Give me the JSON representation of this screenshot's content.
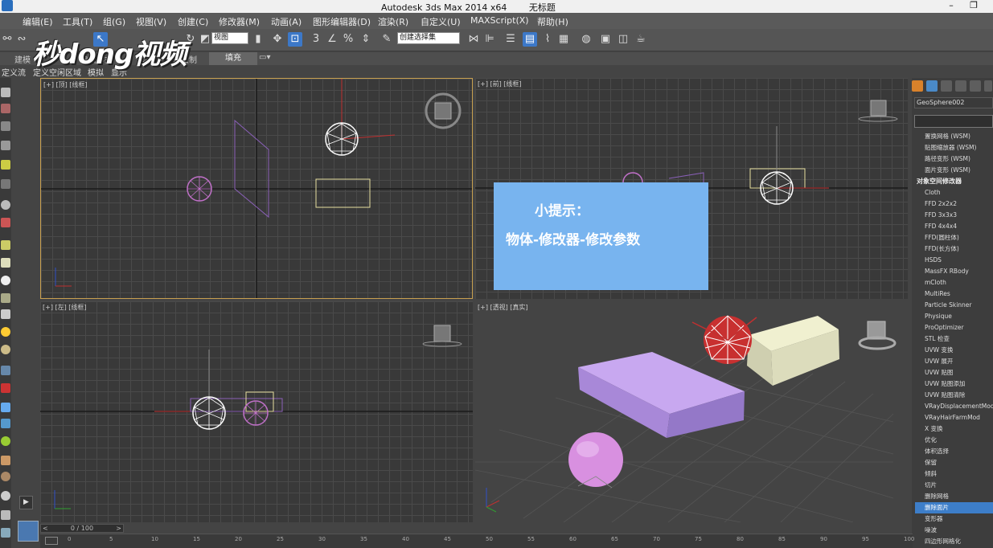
{
  "window": {
    "title_app": "Autodesk 3ds Max  2014 x64",
    "title_doc": "无标题",
    "minimize": "–",
    "restore": "❐"
  },
  "menubar": [
    "编辑(E)",
    "工具(T)",
    "组(G)",
    "视图(V)",
    "创建(C)",
    "修改器(M)",
    "动画(A)",
    "图形编辑器(D)",
    "渲染(R)",
    "自定义(U)",
    "MAXScript(X)",
    "帮助(H)"
  ],
  "toolbar": {
    "view_select": "视图",
    "selection_set": "创建选择集",
    "snap_3": "3",
    "snap_angle": "∠",
    "snap_percent": "%"
  },
  "ribbon": {
    "tabs": [
      "建模",
      "自由形式",
      "选择",
      "对象绘制",
      "填充"
    ],
    "active_tab": "填充",
    "subtabs": [
      "定义流",
      "定义空闲区域",
      "模拟",
      "显示"
    ]
  },
  "logo": "秒dong视频",
  "viewports": {
    "top": "[+] [顶] [线框]",
    "front": "[+] [前] [线框]",
    "left": "[+] [左] [线框]",
    "persp": "[+] [透视] [真实]"
  },
  "tip": {
    "title": "小提示：",
    "body": "物体-修改器-修改参数"
  },
  "command_panel": {
    "object_name": "GeoSphere002",
    "modifiers": [
      {
        "label": "置换网格 (WSM)",
        "header": false,
        "selected": false
      },
      {
        "label": "贴图缩放器 (WSM)",
        "header": false,
        "selected": false
      },
      {
        "label": "路径变形 (WSM)",
        "header": false,
        "selected": false
      },
      {
        "label": "面片变形 (WSM)",
        "header": false,
        "selected": false
      },
      {
        "label": "对象空间修改器",
        "header": true,
        "selected": false
      },
      {
        "label": "Cloth",
        "header": false,
        "selected": false
      },
      {
        "label": "FFD 2x2x2",
        "header": false,
        "selected": false
      },
      {
        "label": "FFD 3x3x3",
        "header": false,
        "selected": false
      },
      {
        "label": "FFD 4x4x4",
        "header": false,
        "selected": false
      },
      {
        "label": "FFD(圆柱体)",
        "header": false,
        "selected": false
      },
      {
        "label": "FFD(长方体)",
        "header": false,
        "selected": false
      },
      {
        "label": "HSDS",
        "header": false,
        "selected": false
      },
      {
        "label": "MassFX RBody",
        "header": false,
        "selected": false
      },
      {
        "label": "mCloth",
        "header": false,
        "selected": false
      },
      {
        "label": "MultiRes",
        "header": false,
        "selected": false
      },
      {
        "label": "Particle Skinner",
        "header": false,
        "selected": false
      },
      {
        "label": "Physique",
        "header": false,
        "selected": false
      },
      {
        "label": "ProOptimizer",
        "header": false,
        "selected": false
      },
      {
        "label": "STL 检查",
        "header": false,
        "selected": false
      },
      {
        "label": "UVW 变换",
        "header": false,
        "selected": false
      },
      {
        "label": "UVW 展开",
        "header": false,
        "selected": false
      },
      {
        "label": "UVW 贴图",
        "header": false,
        "selected": false
      },
      {
        "label": "UVW 贴图添加",
        "header": false,
        "selected": false
      },
      {
        "label": "UVW 贴图清除",
        "header": false,
        "selected": false
      },
      {
        "label": "VRayDisplacementMod",
        "header": false,
        "selected": false
      },
      {
        "label": "VRayHairFarmMod",
        "header": false,
        "selected": false
      },
      {
        "label": "X 变换",
        "header": false,
        "selected": false
      },
      {
        "label": "优化",
        "header": false,
        "selected": false
      },
      {
        "label": "体积选择",
        "header": false,
        "selected": false
      },
      {
        "label": "保留",
        "header": false,
        "selected": false
      },
      {
        "label": "倾斜",
        "header": false,
        "selected": false
      },
      {
        "label": "切片",
        "header": false,
        "selected": false
      },
      {
        "label": "删除网格",
        "header": false,
        "selected": false
      },
      {
        "label": "删除面片",
        "header": false,
        "selected": true
      },
      {
        "label": "变形器",
        "header": false,
        "selected": false
      },
      {
        "label": "噪波",
        "header": false,
        "selected": false
      },
      {
        "label": "四边形网格化",
        "header": false,
        "selected": false
      }
    ]
  },
  "timeline": {
    "slider_label": "0 / 100",
    "ticks": [
      "0",
      "5",
      "10",
      "15",
      "20",
      "25",
      "30",
      "35",
      "40",
      "45",
      "50",
      "55",
      "60",
      "65",
      "70",
      "75",
      "80",
      "85",
      "90",
      "95",
      "100"
    ],
    "prev": "<",
    "next": ">"
  },
  "colors": {
    "selection_purple": "#c070c8",
    "persp_box": "#a890d8",
    "sphere_red": "#c83030",
    "tip_blue": "#78b4ef",
    "accent_blue": "#3d7ec9"
  }
}
